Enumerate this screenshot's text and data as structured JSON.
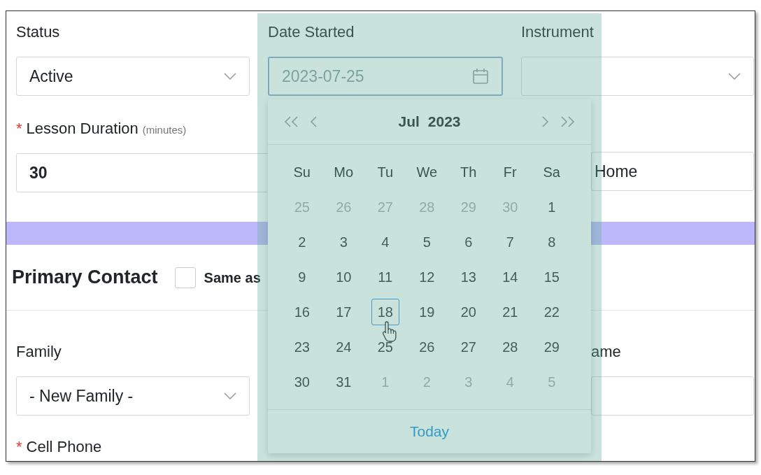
{
  "fields": [
    {
      "label": "Status",
      "kind": "select",
      "value": "Active",
      "focused": false
    },
    {
      "label": "Date Started",
      "kind": "date",
      "value": "2023-07-25",
      "focused": true
    },
    {
      "label": "Instrument",
      "kind": "select",
      "focused": false
    }
  ],
  "lesson_duration": {
    "label": "Lesson Duration",
    "hint": "(minutes)",
    "required_mark": "*",
    "value": "30"
  },
  "location_field": {
    "value": "Home"
  },
  "section": {
    "title": "Primary Contact",
    "checkbox": {
      "label": "Same as",
      "checked": false
    }
  },
  "family": {
    "label": "Family",
    "kind": "select",
    "value": "- New Family -"
  },
  "name_label": "ame",
  "cell_phone": {
    "label": "Cell Phone",
    "required_mark": "*"
  },
  "datepicker": {
    "month": "Jul",
    "year": "2023",
    "weekdays": [
      "Su",
      "Mo",
      "Tu",
      "We",
      "Th",
      "Fr",
      "Sa"
    ],
    "weeks": [
      [
        {
          "day": "25",
          "muted": true,
          "hovered": false
        },
        {
          "day": "26",
          "muted": true,
          "hovered": false
        },
        {
          "day": "27",
          "muted": true,
          "hovered": false
        },
        {
          "day": "28",
          "muted": true,
          "hovered": false
        },
        {
          "day": "29",
          "muted": true,
          "hovered": false
        },
        {
          "day": "30",
          "muted": true,
          "hovered": false
        },
        {
          "day": "1",
          "muted": false,
          "hovered": false
        }
      ],
      [
        {
          "day": "2",
          "muted": false,
          "hovered": false
        },
        {
          "day": "3",
          "muted": false,
          "hovered": false
        },
        {
          "day": "4",
          "muted": false,
          "hovered": false
        },
        {
          "day": "5",
          "muted": false,
          "hovered": false
        },
        {
          "day": "6",
          "muted": false,
          "hovered": false
        },
        {
          "day": "7",
          "muted": false,
          "hovered": false
        },
        {
          "day": "8",
          "muted": false,
          "hovered": false
        }
      ],
      [
        {
          "day": "9",
          "muted": false,
          "hovered": false
        },
        {
          "day": "10",
          "muted": false,
          "hovered": false
        },
        {
          "day": "11",
          "muted": false,
          "hovered": false
        },
        {
          "day": "12",
          "muted": false,
          "hovered": false
        },
        {
          "day": "13",
          "muted": false,
          "hovered": false
        },
        {
          "day": "14",
          "muted": false,
          "hovered": false
        },
        {
          "day": "15",
          "muted": false,
          "hovered": false
        }
      ],
      [
        {
          "day": "16",
          "muted": false,
          "hovered": false
        },
        {
          "day": "17",
          "muted": false,
          "hovered": false
        },
        {
          "day": "18",
          "muted": false,
          "hovered": true
        },
        {
          "day": "19",
          "muted": false,
          "hovered": false
        },
        {
          "day": "20",
          "muted": false,
          "hovered": false
        },
        {
          "day": "21",
          "muted": false,
          "hovered": false
        },
        {
          "day": "22",
          "muted": false,
          "hovered": false
        }
      ],
      [
        {
          "day": "23",
          "muted": false,
          "hovered": false
        },
        {
          "day": "24",
          "muted": false,
          "hovered": false
        },
        {
          "day": "25",
          "muted": false,
          "hovered": false
        },
        {
          "day": "26",
          "muted": false,
          "hovered": false
        },
        {
          "day": "27",
          "muted": false,
          "hovered": false
        },
        {
          "day": "28",
          "muted": false,
          "hovered": false
        },
        {
          "day": "29",
          "muted": false,
          "hovered": false
        }
      ],
      [
        {
          "day": "30",
          "muted": false,
          "hovered": false
        },
        {
          "day": "31",
          "muted": false,
          "hovered": false
        },
        {
          "day": "1",
          "muted": true,
          "hovered": false
        },
        {
          "day": "2",
          "muted": true,
          "hovered": false
        },
        {
          "day": "3",
          "muted": true,
          "hovered": false
        },
        {
          "day": "4",
          "muted": true,
          "hovered": false
        },
        {
          "day": "5",
          "muted": true,
          "hovered": false
        }
      ]
    ],
    "today_button": "Today"
  }
}
